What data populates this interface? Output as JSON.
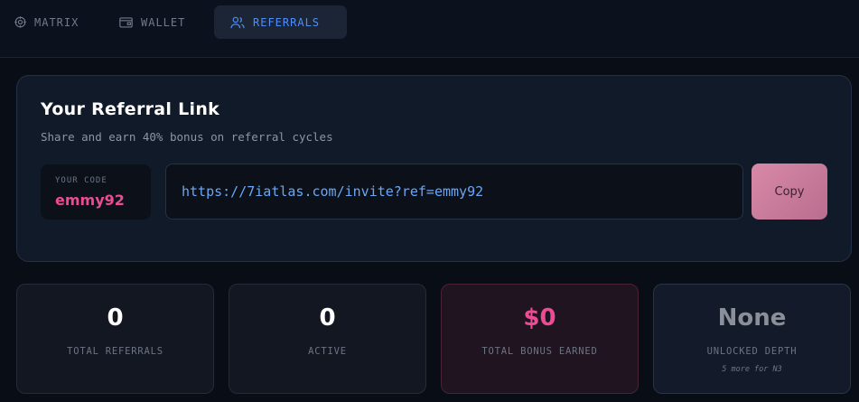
{
  "nav": {
    "tabs": [
      {
        "label": "MATRIX",
        "icon": "target-icon"
      },
      {
        "label": "WALLET",
        "icon": "wallet-icon"
      },
      {
        "label": "REFERRALS",
        "icon": "users-icon",
        "active": true
      }
    ]
  },
  "referral": {
    "title": "Your Referral Link",
    "subtitle": "Share and earn 40% bonus on referral cycles",
    "code_label": "YOUR CODE",
    "code": "emmy92",
    "link": "https://7iatlas.com/invite?ref=emmy92",
    "copy_label": "Copy"
  },
  "stats": [
    {
      "value": "0",
      "label": "TOTAL REFERRALS"
    },
    {
      "value": "0",
      "label": "ACTIVE"
    },
    {
      "value": "$0",
      "label": "TOTAL BONUS EARNED"
    },
    {
      "value": "None",
      "label": "UNLOCKED DEPTH",
      "note": "5 more for N3"
    }
  ],
  "colors": {
    "accent_blue": "#4f8ef7",
    "accent_pink": "#ec4c93",
    "background": "#090d16"
  }
}
